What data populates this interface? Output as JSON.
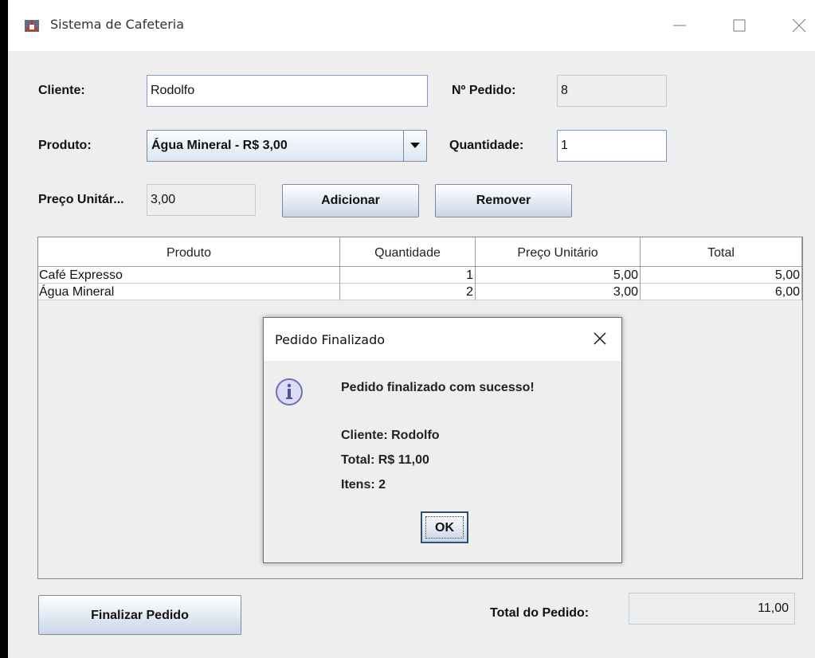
{
  "window": {
    "title": "Sistema de Cafeteria"
  },
  "form": {
    "cliente_label": "Cliente:",
    "cliente_value": "Rodolfo",
    "pedido_label": "Nº Pedido:",
    "pedido_value": "8",
    "produto_label": "Produto:",
    "produto_selected": "Água Mineral - R$ 3,00",
    "quantidade_label": "Quantidade:",
    "quantidade_value": "1",
    "preco_label": "Preço Unitár...",
    "preco_value": "3,00",
    "adicionar_label": "Adicionar",
    "remover_label": "Remover"
  },
  "table": {
    "headers": [
      "Produto",
      "Quantidade",
      "Preço Unitário",
      "Total"
    ],
    "rows": [
      [
        "Café Expresso",
        "1",
        "5,00",
        "5,00"
      ],
      [
        "Água Mineral",
        "2",
        "3,00",
        "6,00"
      ]
    ]
  },
  "footer": {
    "finalizar_label": "Finalizar Pedido",
    "total_label": "Total do Pedido:",
    "total_value": "11,00"
  },
  "dialog": {
    "title": "Pedido Finalizado",
    "message": "Pedido finalizado com sucesso!",
    "cliente": "Cliente: Rodolfo",
    "total": "Total: R$ 11,00",
    "itens": "Itens: 2",
    "ok_label": "OK"
  },
  "icons": {
    "app": "java-cup-icon",
    "dialog": "info-icon"
  }
}
